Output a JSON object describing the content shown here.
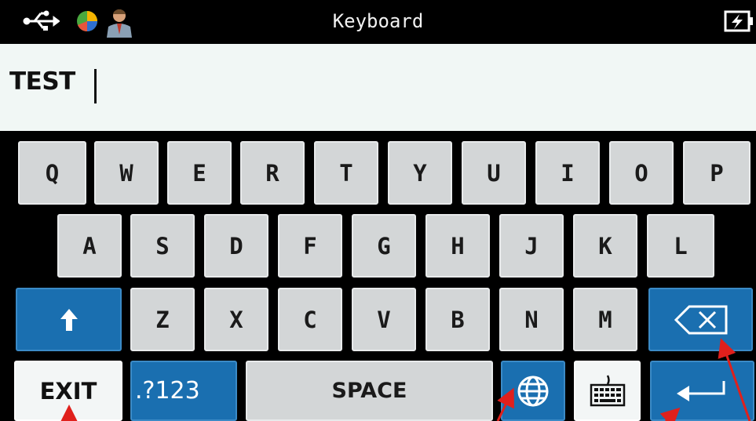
{
  "status_bar": {
    "title": "Keyboard",
    "icons": [
      "usb-icon",
      "pie-chart-icon",
      "user-icon",
      "battery-charging-icon"
    ]
  },
  "input": {
    "value": "TEST"
  },
  "keyboard": {
    "row1": [
      "Q",
      "W",
      "E",
      "R",
      "T",
      "Y",
      "U",
      "I",
      "O",
      "P"
    ],
    "row2": [
      "A",
      "S",
      "D",
      "F",
      "G",
      "H",
      "J",
      "K",
      "L"
    ],
    "row3": [
      "Z",
      "X",
      "C",
      "V",
      "B",
      "N",
      "M"
    ],
    "shift_icon": "shift-arrow-icon",
    "backspace_icon": "backspace-icon",
    "exit_label": "EXIT",
    "symbols_label": ".?123",
    "space_label": "SPACE",
    "globe_icon": "globe-icon",
    "hide_keyboard_icon": "keyboard-icon",
    "enter_icon": "enter-icon"
  },
  "colors": {
    "key": "#d3d6d7",
    "accent_blue": "#1a6fb0",
    "text_field_bg": "#f1f7f5",
    "annotation_red": "#e0201c"
  }
}
